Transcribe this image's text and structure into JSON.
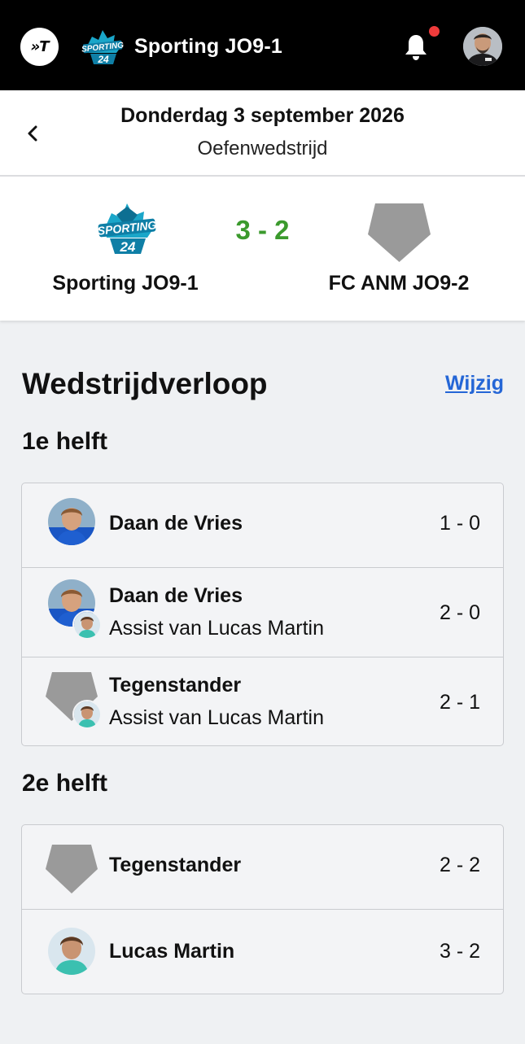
{
  "header": {
    "app_logo_text": "»T",
    "team_name": "Sporting JO9-1"
  },
  "match": {
    "date": "Donderdag 3 september 2026",
    "type": "Oefenwedstrijd",
    "home_team": "Sporting JO9-1",
    "away_team": "FC ANM JO9-2",
    "score": "3 - 2",
    "score_color": "#3b9a2d"
  },
  "timeline": {
    "title": "Wedstrijdverloop",
    "edit_label": "Wijzig",
    "halves": [
      {
        "title": "1e helft",
        "events": [
          {
            "player": "Daan de Vries",
            "assist": "",
            "score": "1 - 0"
          },
          {
            "player": "Daan de Vries",
            "assist": "Assist van Lucas Martin",
            "score": "2 - 0"
          },
          {
            "player": "Tegenstander",
            "assist": "Assist van Lucas Martin",
            "score": "2 - 1"
          }
        ]
      },
      {
        "title": "2e helft",
        "events": [
          {
            "player": "Tegenstander",
            "assist": "",
            "score": "2 - 2"
          },
          {
            "player": "Lucas Martin",
            "assist": "",
            "score": "3 - 2"
          }
        ]
      }
    ]
  },
  "icons": {
    "back": "chevron-left-icon",
    "notifications": "bell-icon",
    "opponent": "pentagon-crest-icon"
  },
  "colors": {
    "topbar": "#000000",
    "link": "#2466d6",
    "notification_dot": "#ef3b3b",
    "background": "#eff1f3"
  }
}
